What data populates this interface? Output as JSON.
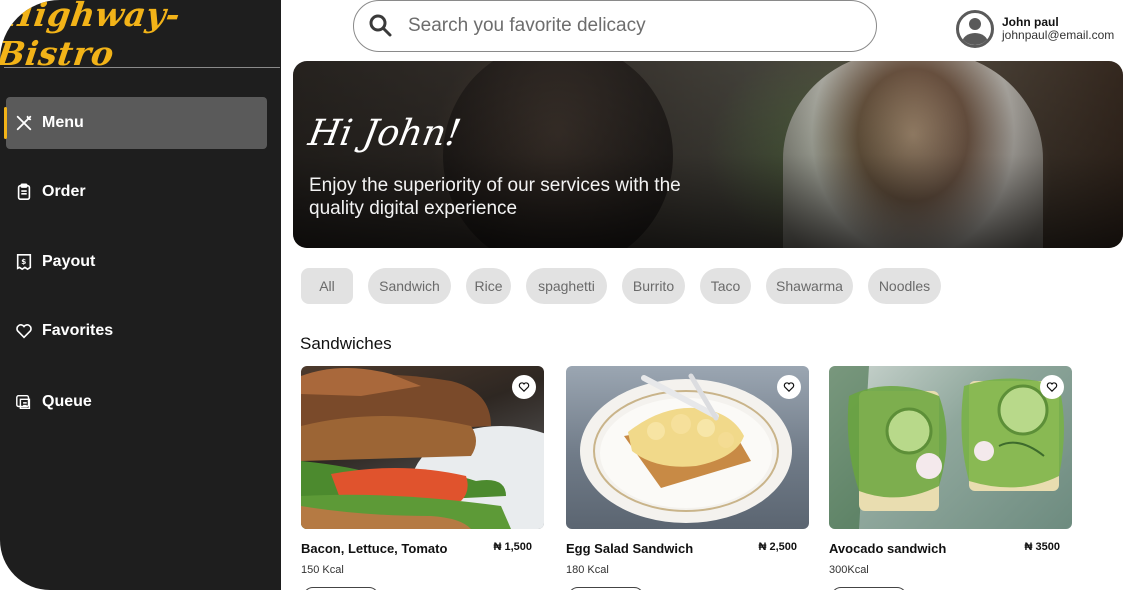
{
  "brand": {
    "name": "Highway-Bistro"
  },
  "sidebar": {
    "items": [
      {
        "label": "Menu",
        "icon": "utensils-icon",
        "active": true
      },
      {
        "label": "Order",
        "icon": "clipboard-icon",
        "active": false
      },
      {
        "label": "Payout",
        "icon": "receipt-icon",
        "active": false
      },
      {
        "label": "Favorites",
        "icon": "heart-icon",
        "active": false
      },
      {
        "label": "Queue",
        "icon": "queue-icon",
        "active": false
      }
    ]
  },
  "search": {
    "placeholder": "Search you favorite delicacy",
    "value": ""
  },
  "user": {
    "name": "John paul",
    "email": "johnpaul@email.com"
  },
  "hero": {
    "title": "Hi John!",
    "subtitle": "Enjoy the superiority of our services with the quality digital experience"
  },
  "categories": [
    "All",
    "Sandwich",
    "Rice",
    "spaghetti",
    "Burrito",
    "Taco",
    "Shawarma",
    "Noodles"
  ],
  "section": {
    "title": "Sandwiches"
  },
  "products": [
    {
      "name": "Bacon, Lettuce, Tomato",
      "price": "₦ 1,500",
      "kcal": "150 Kcal"
    },
    {
      "name": "Egg Salad Sandwich",
      "price": "₦ 2,500",
      "kcal": "180 Kcal"
    },
    {
      "name": "Avocado sandwich",
      "price": "₦ 3500",
      "kcal": "300Kcal"
    }
  ],
  "colors": {
    "accent": "#f2b318",
    "sidebar": "#1e1e1e",
    "active_item": "#5a5a5a",
    "chip": "#e2e2e2"
  }
}
